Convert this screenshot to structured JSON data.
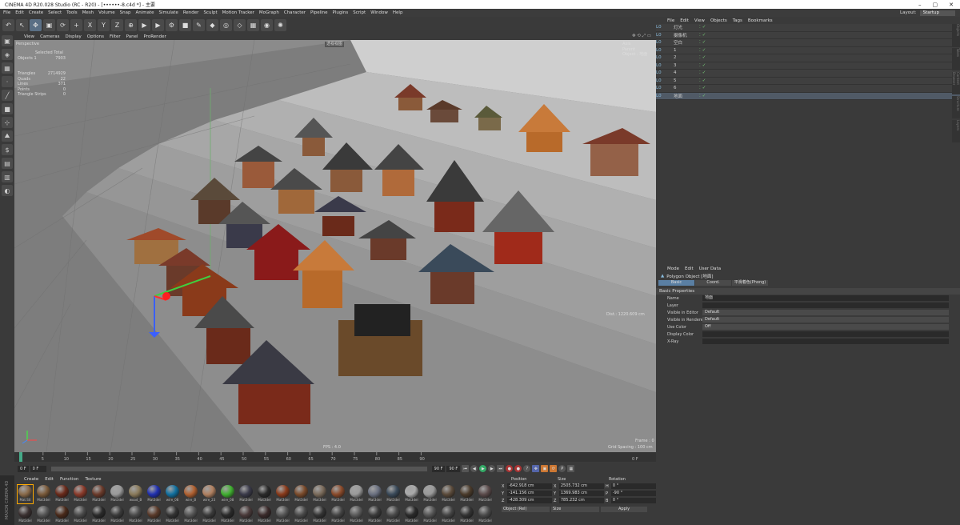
{
  "app": {
    "title": "CINEMA 4D R20.028 Studio (RC - R20) - [••••••-8.c4d *] - 主要"
  },
  "menu": [
    "File",
    "Edit",
    "Create",
    "Select",
    "Tools",
    "Mesh",
    "Volume",
    "Snap",
    "Animate",
    "Simulate",
    "Render",
    "Sculpt",
    "Motion Tracker",
    "MoGraph",
    "Character",
    "Pipeline",
    "Plugins",
    "Script",
    "Window",
    "Help"
  ],
  "layout": {
    "label": "Layout:",
    "value": "Startup"
  },
  "toolbar": {
    "icons": [
      "undo-icon",
      "select-icon",
      "move-icon",
      "scale-icon",
      "rotate-icon",
      "add-icon",
      "x-axis-icon",
      "y-axis-icon",
      "z-axis-icon",
      "world-coord-icon",
      "render-view-icon",
      "render-picture-icon",
      "render-settings-icon",
      "cube-icon",
      "pen-icon",
      "subdivide-icon",
      "cloner-icon",
      "deformer-icon",
      "scene-icon",
      "camera-icon",
      "light-icon"
    ],
    "axes": [
      "X",
      "Y",
      "Z"
    ]
  },
  "viewport": {
    "menu": [
      "View",
      "Cameras",
      "Display",
      "Options",
      "Filter",
      "Panel",
      "ProRender"
    ],
    "label": "Perspective",
    "stats": {
      "header": "Selected Total",
      "objects_label": "Objects",
      "objects_sel": "1",
      "objects_total": "7903",
      "triangles_label": "Triangles",
      "triangles": "2714929",
      "quads_label": "Quads",
      "quads": "22",
      "lines_label": "Lines",
      "lines": "371",
      "points_label": "Points",
      "points": "0",
      "strips_label": "Triangle Strips",
      "strips": "0"
    },
    "tag": "透视视图",
    "axis_widget": [
      "Axis",
      "Parent",
      "Object : 地面"
    ],
    "dist": "Dist.: 1220.609 cm",
    "fps": "FPS : 4.0",
    "frame": "Frame : 0",
    "grid": "Grid Spacing : 100 cm"
  },
  "timeline": {
    "ticks": [
      "0",
      "5",
      "10",
      "15",
      "20",
      "25",
      "30",
      "35",
      "40",
      "45",
      "50",
      "55",
      "60",
      "65",
      "70",
      "75",
      "80",
      "85",
      "90"
    ],
    "end": "0 F"
  },
  "transport": {
    "start": "0 F",
    "cur": "0 F",
    "end": "90 F",
    "end2": "90 F"
  },
  "materials": {
    "menu": [
      "Create",
      "Edit",
      "Function",
      "Texture"
    ],
    "items": [
      {
        "n": "Mat.Stl",
        "c": "#8a6a4a"
      },
      {
        "n": "Mat3del",
        "c": "#7a5a3a"
      },
      {
        "n": "Mat3del",
        "c": "#6a2a1a"
      },
      {
        "n": "Mat3del",
        "c": "#8a3a2a"
      },
      {
        "n": "Mat3del",
        "c": "#6a3a2a"
      },
      {
        "n": "Mat3del",
        "c": "#9a9a9a"
      },
      {
        "n": "wood_B",
        "c": "#8a7a5a"
      },
      {
        "n": "Mat3del",
        "c": "#2030b0"
      },
      {
        "n": "wire_08",
        "c": "#1070a0"
      },
      {
        "n": "wire_B",
        "c": "#b06030"
      },
      {
        "n": "wire_23",
        "c": "#b08060"
      },
      {
        "n": "wire_08",
        "c": "#40b030"
      },
      {
        "n": "Mat3del",
        "c": "#3a3a4a"
      },
      {
        "n": "Mat3del",
        "c": "#2a2a2a"
      },
      {
        "n": "Mat3del",
        "c": "#8a3a1a"
      },
      {
        "n": "Mat3del",
        "c": "#7a4a2a"
      },
      {
        "n": "Mat3del",
        "c": "#7a6a5a"
      },
      {
        "n": "Mat3del",
        "c": "#8a4a2a"
      },
      {
        "n": "Mat3del",
        "c": "#9a9a9a"
      },
      {
        "n": "Mat3del",
        "c": "#6a7080"
      },
      {
        "n": "Mat3del",
        "c": "#3a4a5a"
      },
      {
        "n": "Mat3del",
        "c": "#aaaaaa"
      },
      {
        "n": "Mat3del",
        "c": "#9a9a9a"
      },
      {
        "n": "Mat3del",
        "c": "#5a4a3a"
      },
      {
        "n": "Mat3del",
        "c": "#4a3a2a"
      },
      {
        "n": "Mat3del",
        "c": "#5a4a4a"
      },
      {
        "n": "Mat3del",
        "c": "#3a3030"
      },
      {
        "n": "Mat3del",
        "c": "#555555"
      },
      {
        "n": "Mat3del",
        "c": "#4a2a1a"
      },
      {
        "n": "Mat3del",
        "c": "#4a4a4a"
      },
      {
        "n": "Mat3del",
        "c": "#2a2a2a"
      },
      {
        "n": "Mat3del",
        "c": "#3a3a3a"
      },
      {
        "n": "Mat3del",
        "c": "#4a4a4a"
      },
      {
        "n": "Mat3del",
        "c": "#5a3a2a"
      },
      {
        "n": "Mat3del",
        "c": "#333333"
      },
      {
        "n": "Mat3del",
        "c": "#555555"
      },
      {
        "n": "Mat3del",
        "c": "#3a3a3a"
      },
      {
        "n": "Mat3del",
        "c": "#2a2a2a"
      },
      {
        "n": "Mat3del",
        "c": "#4a3a3a"
      },
      {
        "n": "Mat3del",
        "c": "#3a2a2a"
      },
      {
        "n": "Mat3del",
        "c": "#555555"
      },
      {
        "n": "Mat3del",
        "c": "#4a4a4a"
      },
      {
        "n": "Mat3del",
        "c": "#333333"
      },
      {
        "n": "Mat3del",
        "c": "#444444"
      },
      {
        "n": "Mat3del",
        "c": "#5a5a5a"
      },
      {
        "n": "Mat3del",
        "c": "#3a3a3a"
      },
      {
        "n": "Mat3del",
        "c": "#4a4a4a"
      },
      {
        "n": "Mat3del",
        "c": "#2a2a2a"
      },
      {
        "n": "Mat3del",
        "c": "#555555"
      },
      {
        "n": "Mat3del",
        "c": "#444444"
      },
      {
        "n": "Mat3del",
        "c": "#333333"
      },
      {
        "n": "Mat3del",
        "c": "#4a4a4a"
      }
    ]
  },
  "coords": {
    "headers": [
      "Position",
      "Size",
      "Rotation"
    ],
    "rows": [
      [
        "X",
        "-642.918 cm",
        "X",
        "2505.732 cm",
        "H",
        "0 °"
      ],
      [
        "Y",
        "-141.156 cm",
        "Y",
        "1369.983 cm",
        "P",
        "-90 °"
      ],
      [
        "Z",
        "-428.309 cm",
        "Z",
        "785.232 cm",
        "B",
        "0 °"
      ]
    ],
    "mode": "Object (Rel)",
    "size_mode": "Size",
    "apply": "Apply"
  },
  "objmgr": {
    "menu": [
      "File",
      "Edit",
      "View",
      "Objects",
      "Tags",
      "Bookmarks"
    ],
    "rows": [
      {
        "n": "灯光"
      },
      {
        "n": "摄像机"
      },
      {
        "n": "空白"
      },
      {
        "n": "1"
      },
      {
        "n": "2"
      },
      {
        "n": "3"
      },
      {
        "n": "4"
      },
      {
        "n": "5"
      },
      {
        "n": "6"
      },
      {
        "n": "地面"
      }
    ]
  },
  "attrs": {
    "menu": [
      "Mode",
      "Edit",
      "User Data"
    ],
    "object": "Polygon Object [地面]",
    "tabs": [
      "Basic",
      "Coord.",
      "平滑着色(Phong)"
    ],
    "section": "Basic Properties",
    "props": [
      {
        "l": "Name",
        "v": "地面"
      },
      {
        "l": "Layer",
        "v": ""
      },
      {
        "l": "Visible in Editor",
        "v": "Default"
      },
      {
        "l": "Visible in Renderer",
        "v": "Default"
      },
      {
        "l": "Use Color",
        "v": "Off"
      },
      {
        "l": "Display Color",
        "v": ""
      },
      {
        "l": "X-Ray",
        "v": ""
      }
    ]
  },
  "right_tabs": [
    "Objects",
    "Takes",
    "Content Browser",
    "Structure",
    "Layers"
  ]
}
